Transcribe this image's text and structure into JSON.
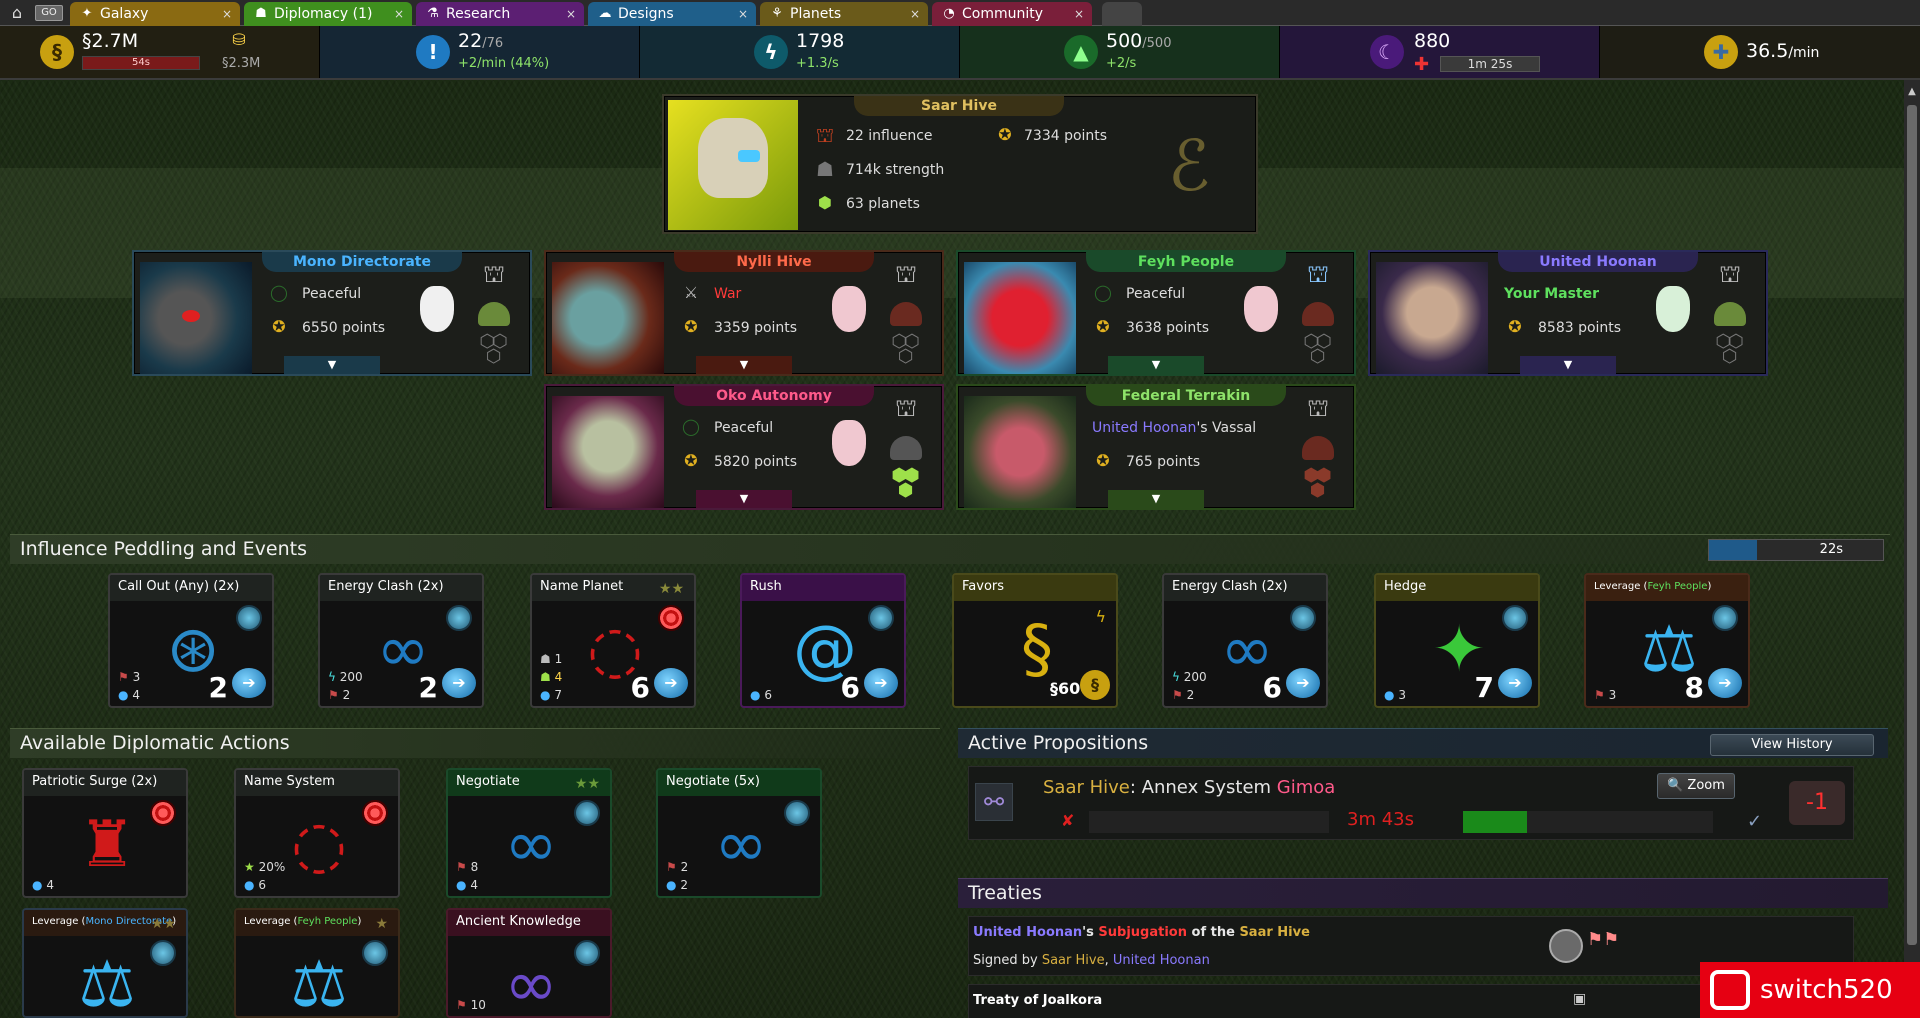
{
  "tabs": [
    {
      "label": "Galaxy",
      "color": "#8a6a12",
      "icon": "galaxy-icon"
    },
    {
      "label": "Diplomacy (1)",
      "color": "#3f8f1e",
      "icon": "diplomacy-icon"
    },
    {
      "label": "Research",
      "color": "#5c1f73",
      "icon": "research-icon"
    },
    {
      "label": "Designs",
      "color": "#1f5f8a",
      "icon": "designs-icon"
    },
    {
      "label": "Planets",
      "color": "#6a5a1a",
      "icon": "planets-icon"
    },
    {
      "label": "Community",
      "color": "#7a1f3a",
      "icon": "community-icon"
    }
  ],
  "go_label": "GO",
  "resources": {
    "money": {
      "value": "§2.7M",
      "timer": "54s",
      "sub": "§2.3M"
    },
    "influence": {
      "value": "22",
      "max": "/76",
      "rate": "+2/min (44%)"
    },
    "energy": {
      "value": "1798",
      "rate": "+1.3/s"
    },
    "fp": {
      "value": "500",
      "max": "/500",
      "rate": "+2/s"
    },
    "research": {
      "value": "880",
      "timer": "1m 25s"
    },
    "defense": {
      "value": "36.5",
      "unit": "/min"
    }
  },
  "main_empire": {
    "name": "Saar Hive",
    "influence": "22 influence",
    "points": "7334 points",
    "strength": "714k strength",
    "planets": "63 planets"
  },
  "empires": [
    {
      "name": "Mono Directorate",
      "status": "Peaceful",
      "points": "6550 points",
      "name_color": "#4ab4ff"
    },
    {
      "name": "Nylli Hive",
      "status": "War",
      "points": "3359 points",
      "name_color": "#ff6a4a"
    },
    {
      "name": "Feyh People",
      "status": "Peaceful",
      "points": "3638 points",
      "name_color": "#5ee05e"
    },
    {
      "name": "United Hoonan",
      "status": "Your Master",
      "points": "8583 points",
      "name_color": "#8a7aff"
    },
    {
      "name": "Oko Autonomy",
      "status": "Peaceful",
      "points": "5820 points",
      "name_color": "#ff5a8a"
    },
    {
      "name": "Federal Terrakin",
      "status_owner": "United Hoonan",
      "status_suffix": "'s Vassal",
      "points": "765 points",
      "name_color": "#8ee36a"
    }
  ],
  "expander_label": "▼",
  "influence_section": {
    "title": "Influence Peddling and Events",
    "timer": "22s"
  },
  "influence_cards": [
    {
      "title": "Call Out (Any) (2x)",
      "cost1": "3",
      "cost2": "4",
      "num": "2"
    },
    {
      "title": "Energy Clash (2x)",
      "cost1": "200",
      "cost2": "2",
      "num": "2"
    },
    {
      "title": "Name Planet",
      "cost1": "1",
      "cost_mid": "4",
      "cost2": "7",
      "num": "6"
    },
    {
      "title": "Rush",
      "cost2": "6",
      "num": "6"
    },
    {
      "title": "Favors",
      "price": "§600k"
    },
    {
      "title": "Energy Clash (2x)",
      "cost1": "200",
      "cost2": "2",
      "num": "6"
    },
    {
      "title": "Hedge",
      "cost2": "3",
      "num": "7"
    },
    {
      "title_prefix": "Leverage (",
      "title_target": "Feyh People",
      "title_suffix": ")",
      "cost2": "3",
      "num": "8"
    }
  ],
  "diplomatic_section": {
    "title": "Available Diplomatic Actions"
  },
  "diplomatic_cards": [
    {
      "title": "Patriotic Surge (2x)",
      "cost2": "4"
    },
    {
      "title": "Name System",
      "cost1": "20%",
      "cost2": "6"
    },
    {
      "title": "Negotiate",
      "cost1": "8",
      "cost2": "4"
    },
    {
      "title": "Negotiate (5x)",
      "cost1": "2",
      "cost2": "2"
    },
    {
      "title_prefix": "Leverage (",
      "title_target": "Mono Directorate",
      "title_suffix": ")"
    },
    {
      "title_prefix": "Leverage (",
      "title_target": "Feyh People",
      "title_suffix": ")"
    },
    {
      "title": "Ancient Knowledge",
      "cost1": "10"
    }
  ],
  "propositions": {
    "title": "Active Propositions",
    "history_button": "View History",
    "item": {
      "empire": "Saar Hive",
      "sep": ":",
      "action": " Annex System ",
      "target": "Gimoa",
      "timer": "3m 43s",
      "zoom": "Zoom",
      "vote": "-1"
    }
  },
  "treaties": {
    "title": "Treaties",
    "item1": {
      "a": "United Hoonan",
      "b": "'s ",
      "c": "Subjugation",
      "d": " of the ",
      "e": "Saar Hive",
      "signed_prefix": "Signed by ",
      "s1": "Saar Hive",
      "sep": ", ",
      "s2": "United Hoonan"
    },
    "item2": {
      "title": "Treaty of Joalkora"
    }
  },
  "watermark": "switch520"
}
